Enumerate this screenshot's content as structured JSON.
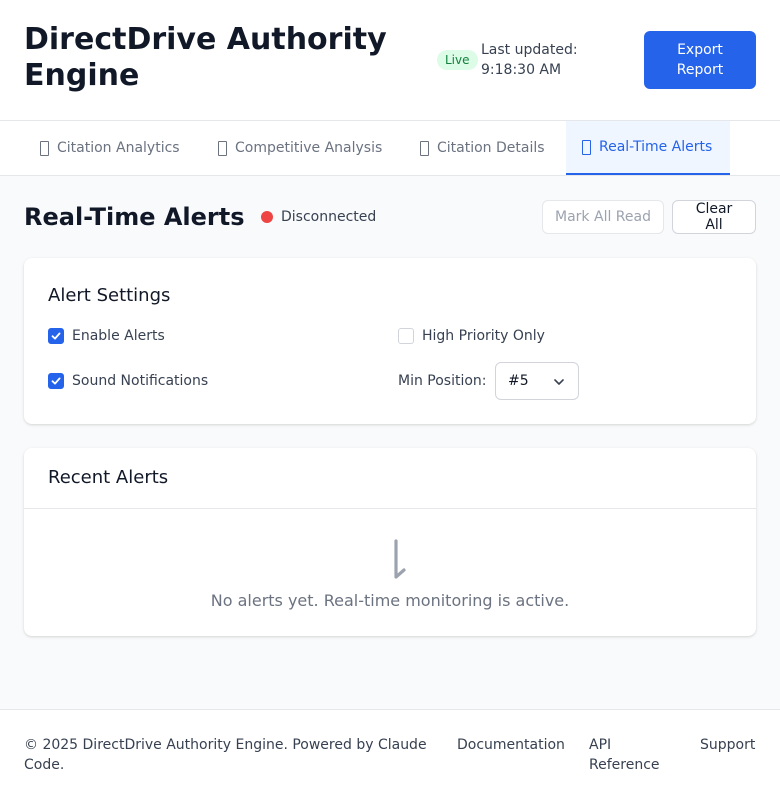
{
  "header": {
    "title": "DirectDrive Authority Engine",
    "live_badge": "Live",
    "last_updated": "Last updated: 9:18:30 AM",
    "export_label": "Export Report"
  },
  "tabs": [
    {
      "label": "Citation Analytics",
      "active": false
    },
    {
      "label": "Competitive Analysis",
      "active": false
    },
    {
      "label": "Citation Details",
      "active": false
    },
    {
      "label": "Real-Time Alerts",
      "active": true
    }
  ],
  "alerts_page": {
    "title": "Real-Time Alerts",
    "connection_status": "Disconnected",
    "mark_all_read_label": "Mark All Read",
    "clear_all_label": "Clear All"
  },
  "settings": {
    "title": "Alert Settings",
    "enable_alerts": {
      "label": "Enable Alerts",
      "checked": true
    },
    "high_priority_only": {
      "label": "High Priority Only",
      "checked": false
    },
    "sound_notifications": {
      "label": "Sound Notifications",
      "checked": true
    },
    "min_position": {
      "label": "Min Position:",
      "value": "#5"
    }
  },
  "recent_alerts": {
    "title": "Recent Alerts",
    "empty_icon": "bell-icon",
    "empty_message": "No alerts yet. Real-time monitoring is active."
  },
  "footer": {
    "copyright": "© 2025 DirectDrive Authority Engine. Powered by Claude Code.",
    "links": [
      "Documentation",
      "API Reference",
      "Support"
    ]
  },
  "colors": {
    "accent": "#2563eb",
    "live_bg": "#dcfce7",
    "live_text": "#15803d",
    "disconnected": "#ef4444"
  }
}
